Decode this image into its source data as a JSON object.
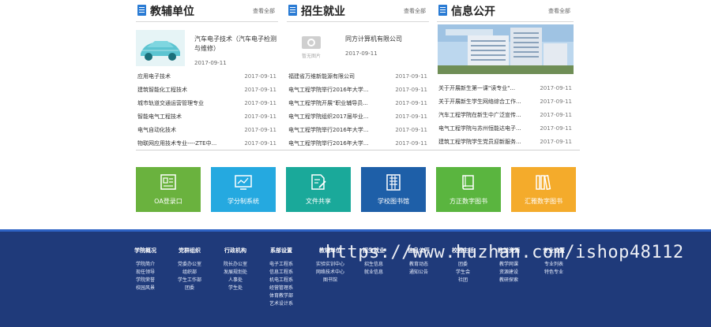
{
  "columns": [
    {
      "title": "教辅单位",
      "more": "查看全部",
      "featured": {
        "title": "汽车电子技术（汽车电子检测与维修）",
        "date": "2017-09-11"
      },
      "items": [
        {
          "text": "应用电子技术",
          "date": "2017-09-11"
        },
        {
          "text": "建筑智能化工程技术",
          "date": "2017-09-11"
        },
        {
          "text": "城市轨道交通运营管理专业",
          "date": "2017-09-11"
        },
        {
          "text": "智能电气工程技术",
          "date": "2017-09-11"
        },
        {
          "text": "电气自动化技术",
          "date": "2017-09-11"
        },
        {
          "text": "物联网应用技术专业----ZTE中...",
          "date": "2017-09-11"
        }
      ]
    },
    {
      "title": "招生就业",
      "more": "查看全部",
      "featured": {
        "title": "同方计算机有限公司",
        "date": "2017-09-11",
        "logo_text": "暂无图片"
      },
      "items": [
        {
          "text": "福建省万维新能源有限公司",
          "date": "2017-09-11"
        },
        {
          "text": "电气工程学院举行2016年大学...",
          "date": "2017-09-11"
        },
        {
          "text": "电气工程学院开展\"职业辅导员...",
          "date": "2017-09-11"
        },
        {
          "text": "电气工程学院组织2017届毕业...",
          "date": "2017-09-11"
        },
        {
          "text": "电气工程学院举行2016年大学...",
          "date": "2017-09-11"
        },
        {
          "text": "电气工程学院举行2016年大学...",
          "date": "2017-09-11"
        }
      ]
    },
    {
      "title": "信息公开",
      "more": "查看全部",
      "items": [
        {
          "text": "关于开展新生第一课\"读专业\"...",
          "date": "2017-09-11"
        },
        {
          "text": "关于开展新生学生网络综合工作...",
          "date": "2017-09-11"
        },
        {
          "text": "汽车工程学院在新生中广泛宣传...",
          "date": "2017-09-11"
        },
        {
          "text": "电气工程学院与苏州恒能达电子...",
          "date": "2017-09-11"
        },
        {
          "text": "建筑工程学院学生党员迎新服务...",
          "date": "2017-09-11"
        }
      ]
    }
  ],
  "tiles": [
    {
      "label": "OA登录口",
      "color": "#6ab23e",
      "icon": "id-card-icon"
    },
    {
      "label": "学分制系统",
      "color": "#25a9e0",
      "icon": "chart-monitor-icon"
    },
    {
      "label": "文件共享",
      "color": "#1aa99a",
      "icon": "document-edit-icon"
    },
    {
      "label": "学校图书馆",
      "color": "#1e5fa8",
      "icon": "building-icon"
    },
    {
      "label": "方正数字图书",
      "color": "#5ab53f",
      "icon": "book-icon"
    },
    {
      "label": "汇雅数字图书",
      "color": "#f4ab2b",
      "icon": "books-icon"
    }
  ],
  "footer": {
    "columns": [
      {
        "title": "学院概况",
        "items": [
          "学院简介",
          "现任领导",
          "学院荣誉",
          "校园风景"
        ]
      },
      {
        "title": "党群组织",
        "items": [
          "党委办公室",
          "组织部",
          "学生工作部",
          "团委"
        ]
      },
      {
        "title": "行政机构",
        "items": [
          "院长办公室",
          "发展规划处",
          "人事处",
          "学生处"
        ]
      },
      {
        "title": "系部设置",
        "items": [
          "电子工程系",
          "信息工程系",
          "机电工程系",
          "经营管理系",
          "体育教学部",
          "艺术设计系"
        ]
      },
      {
        "title": "教辅单位",
        "items": [
          "实验实训中心",
          "网络技术中心",
          "图书馆"
        ]
      },
      {
        "title": "招生就业",
        "items": [
          "招生信息",
          "就业信息"
        ]
      },
      {
        "title": "信息公开",
        "items": [
          "教育动态",
          "通知公告"
        ]
      },
      {
        "title": "校园生活",
        "items": [
          "团委",
          "学生会",
          "社团"
        ]
      },
      {
        "title": "教学资源",
        "items": [
          "教学网课",
          "资源建设",
          "教研探索"
        ]
      },
      {
        "title": "专业设置",
        "items": [
          "专业列表",
          "特色专业"
        ]
      }
    ],
    "watermark": "https://www.huzhan.com/ishop48112"
  }
}
